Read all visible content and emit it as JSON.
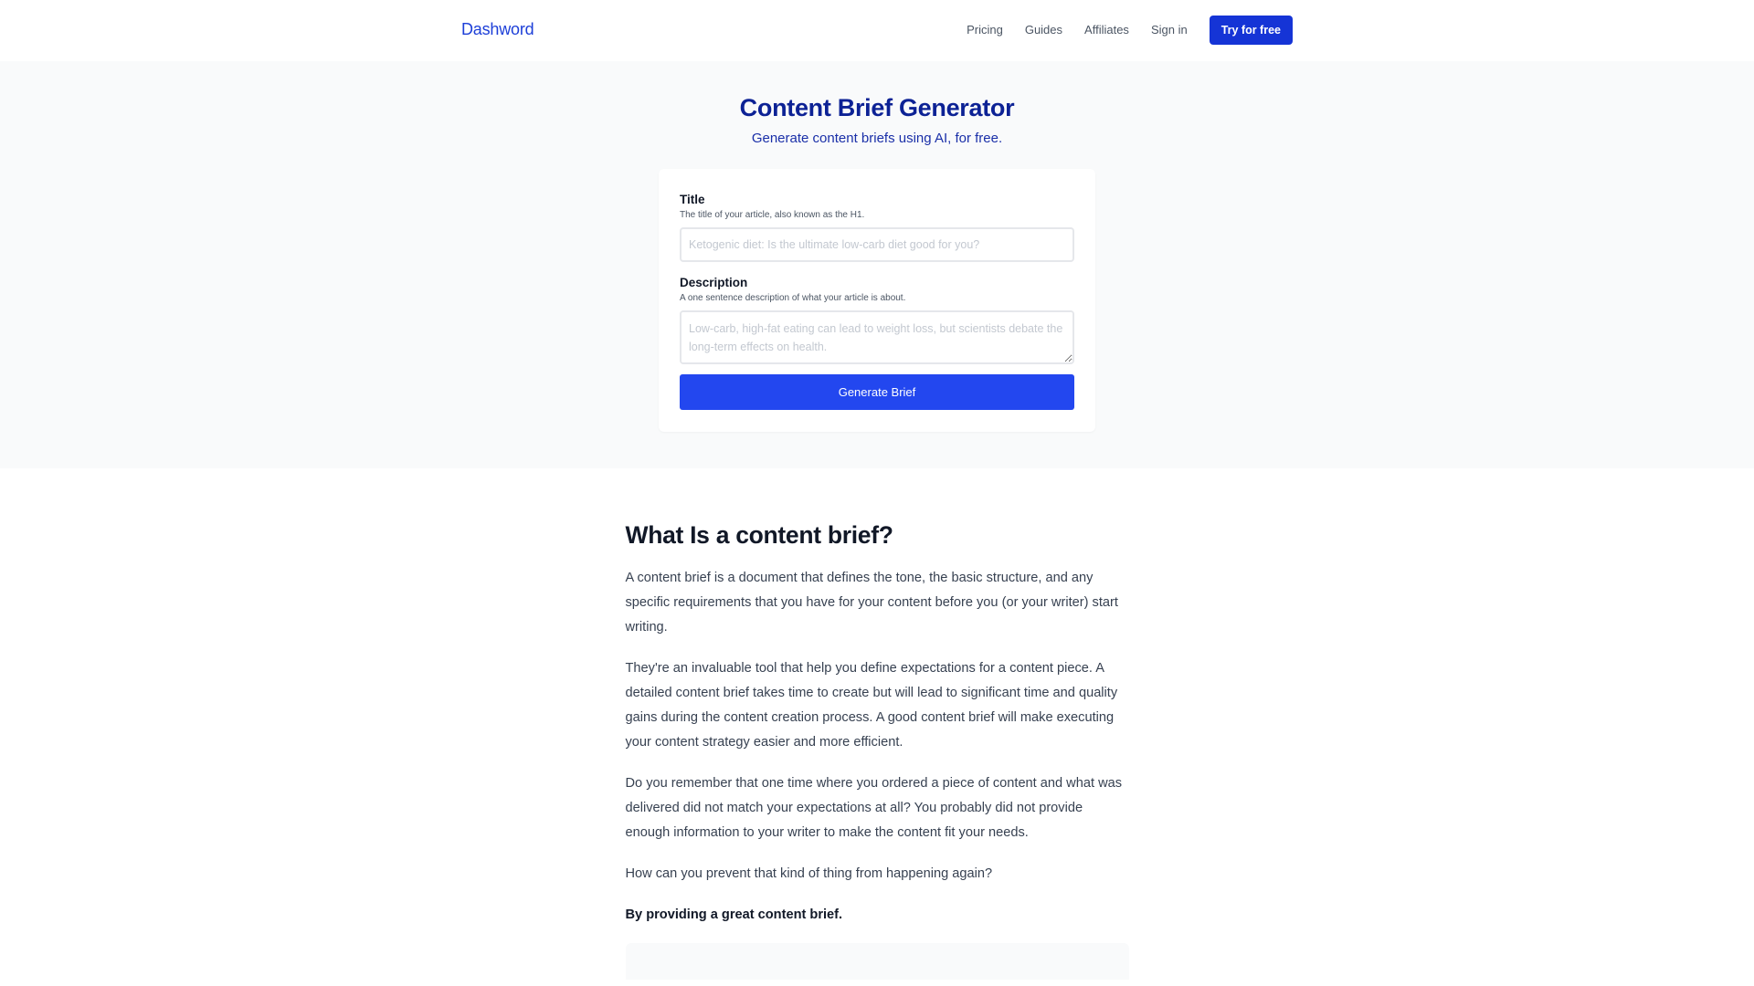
{
  "nav": {
    "brand": "Dashword",
    "links": [
      "Pricing",
      "Guides",
      "Affiliates",
      "Sign in"
    ],
    "cta": "Try for free"
  },
  "hero": {
    "title": "Content Brief Generator",
    "subtitle": "Generate content briefs using AI, for free."
  },
  "form": {
    "title_label": "Title",
    "title_help": "The title of your article, also known as the H1.",
    "title_placeholder": "Ketogenic diet: Is the ultimate low-carb diet good for you?",
    "description_label": "Description",
    "description_help": "A one sentence description of what your article is about.",
    "description_placeholder": "Low-carb, high-fat eating can lead to weight loss, but scientists debate the long-term effects on health.",
    "submit": "Generate Brief"
  },
  "article": {
    "heading": "What Is a content brief?",
    "paragraphs": [
      "A content brief is a document that defines the tone, the basic structure, and any specific requirements that you have for your content before you (or your writer) start writing.",
      "They're an invaluable tool that help you define expectations for a content piece. A detailed content brief takes time to create but will lead to significant time and quality gains during the content creation process. A good content brief will make executing your content strategy easier and more efficient.",
      "Do you remember that one time where you ordered a piece of content and what was delivered did not match your expectations at all? You probably did not provide enough information to your writer to make the content fit your needs.",
      "How can you prevent that kind of thing from happening again?"
    ],
    "emphasis": "By providing a great content brief."
  },
  "colors": {
    "brand": "#1d3fd8",
    "cta": "#1534d6",
    "generate_button": "#2347ef",
    "hero_title": "#0d2295",
    "hero_background": "#f9fafb"
  }
}
